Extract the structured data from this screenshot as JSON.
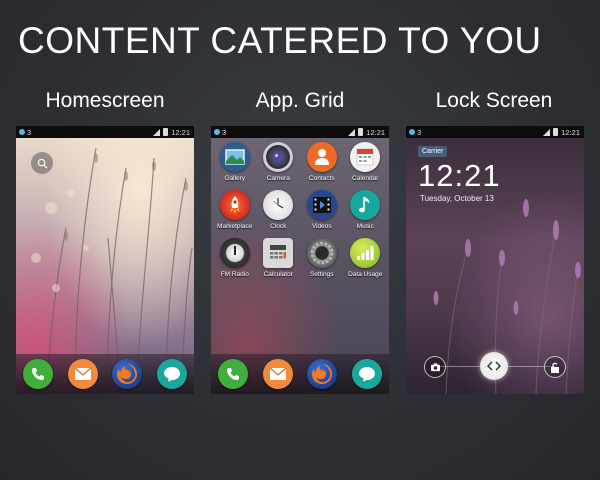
{
  "headline": "CONTENT CATERED TO YOU",
  "columns": {
    "home": "Homescreen",
    "grid": "App. Grid",
    "lock": "Lock Screen"
  },
  "status": {
    "notification_count": "3",
    "time": "12:21"
  },
  "dock": [
    {
      "name": "phone-icon",
      "color": "#3fae3a"
    },
    {
      "name": "messages-icon",
      "color": "#f28a3b"
    },
    {
      "name": "firefox-icon",
      "color": "#1c3f8f"
    },
    {
      "name": "chat-icon",
      "color": "#1aa89a"
    }
  ],
  "apps": [
    {
      "label": "Gallery",
      "icon": "gallery-icon",
      "color": "#2d5f8e"
    },
    {
      "label": "Camera",
      "icon": "camera-icon",
      "color": "#4b4f63"
    },
    {
      "label": "Contacts",
      "icon": "contacts-icon",
      "color": "#ef6b25"
    },
    {
      "label": "Calendar",
      "icon": "calendar-icon",
      "color": "#f2f2f2"
    },
    {
      "label": "Marketplace",
      "icon": "marketplace-icon",
      "color": "#e33a2b"
    },
    {
      "label": "Clock",
      "icon": "clock-icon",
      "color": "#e5e5e5"
    },
    {
      "label": "Videos",
      "icon": "videos-icon",
      "color": "#25488f"
    },
    {
      "label": "Music",
      "icon": "music-icon",
      "color": "#16a89c"
    },
    {
      "label": "FM Radio",
      "icon": "fm-radio-icon",
      "color": "#3a3a3a"
    },
    {
      "label": "Calculator",
      "icon": "calculator-icon",
      "color": "#d9d9d9"
    },
    {
      "label": "Settings",
      "icon": "settings-icon",
      "color": "#6a6a6a"
    },
    {
      "label": "Data Usage",
      "icon": "data-usage-icon",
      "color": "#9bc733"
    }
  ],
  "lock": {
    "carrier": "Carrier",
    "time": "12:21",
    "date": "Tuesday, October 13"
  }
}
